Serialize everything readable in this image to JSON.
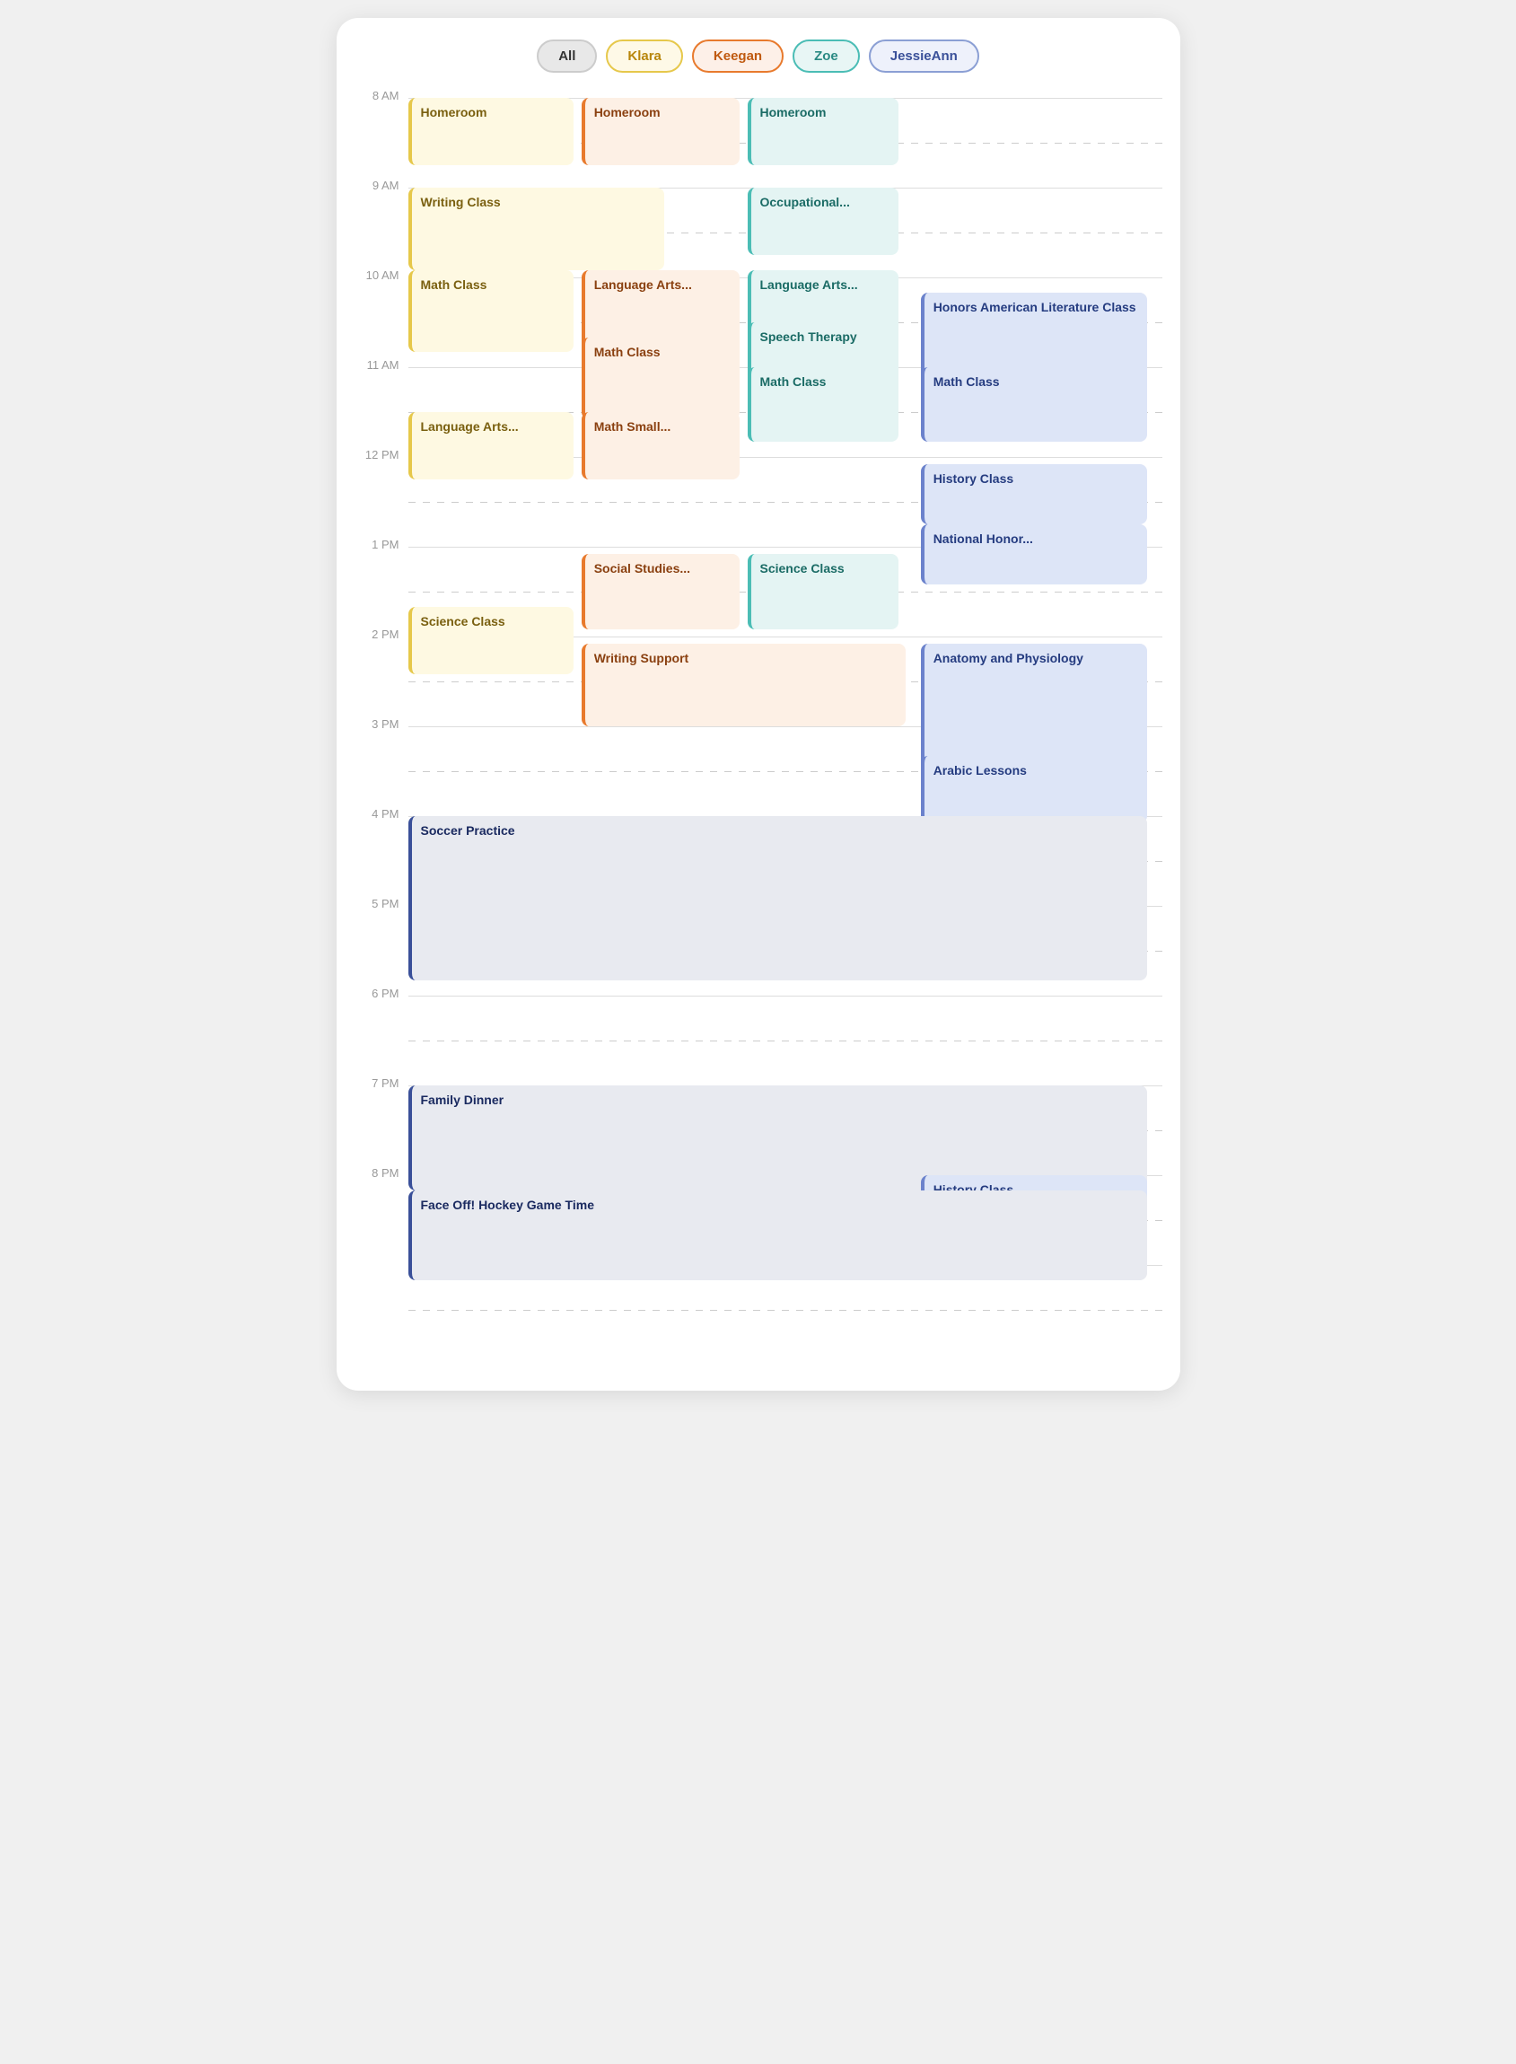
{
  "filters": [
    {
      "id": "all",
      "label": "All",
      "class": "active"
    },
    {
      "id": "klara",
      "label": "Klara",
      "class": "klara"
    },
    {
      "id": "keegan",
      "label": "Keegan",
      "class": "keegan"
    },
    {
      "id": "zoe",
      "label": "Zoe",
      "class": "zoe"
    },
    {
      "id": "jessieann",
      "label": "JessieAnn",
      "class": "jessieann"
    }
  ],
  "hours": [
    {
      "label": "8 AM"
    },
    {
      "label": "9 AM"
    },
    {
      "label": "10 AM"
    },
    {
      "label": "11 AM"
    },
    {
      "label": "12 PM"
    },
    {
      "label": "1 PM"
    },
    {
      "label": "2 PM"
    },
    {
      "label": "3 PM"
    },
    {
      "label": "4 PM"
    },
    {
      "label": "5 PM"
    },
    {
      "label": "6 PM"
    },
    {
      "label": "7 PM"
    },
    {
      "label": "8 PM"
    },
    {
      "label": ""
    }
  ],
  "events": [
    {
      "title": "Homeroom",
      "owner": "klara",
      "top_hour": 0,
      "top_min": 0,
      "dur_min": 45,
      "left_pct": 0,
      "width_pct": 22
    },
    {
      "title": "Homeroom",
      "owner": "keegan",
      "top_hour": 0,
      "top_min": 0,
      "dur_min": 45,
      "left_pct": 23,
      "width_pct": 21
    },
    {
      "title": "Homeroom",
      "owner": "zoe",
      "top_hour": 0,
      "top_min": 0,
      "dur_min": 45,
      "left_pct": 45,
      "width_pct": 20
    },
    {
      "title": "Writing Class",
      "owner": "klara",
      "top_hour": 1,
      "top_min": 0,
      "dur_min": 55,
      "left_pct": 0,
      "width_pct": 34
    },
    {
      "title": "Occupational...",
      "owner": "zoe",
      "top_hour": 1,
      "top_min": 0,
      "dur_min": 45,
      "left_pct": 45,
      "width_pct": 20
    },
    {
      "title": "Math Class",
      "owner": "klara",
      "top_hour": 1,
      "top_min": 55,
      "dur_min": 55,
      "left_pct": 0,
      "width_pct": 22
    },
    {
      "title": "Language Arts...",
      "owner": "keegan",
      "top_hour": 1,
      "top_min": 55,
      "dur_min": 55,
      "left_pct": 23,
      "width_pct": 21
    },
    {
      "title": "Language Arts...",
      "owner": "zoe",
      "top_hour": 1,
      "top_min": 55,
      "dur_min": 55,
      "left_pct": 45,
      "width_pct": 20
    },
    {
      "title": "Honors American Literature Class",
      "owner": "jessieann",
      "top_hour": 2,
      "top_min": 10,
      "dur_min": 80,
      "left_pct": 68,
      "width_pct": 30
    },
    {
      "title": "Math Class",
      "owner": "keegan",
      "top_hour": 2,
      "top_min": 40,
      "dur_min": 55,
      "left_pct": 23,
      "width_pct": 21
    },
    {
      "title": "Speech Therapy",
      "owner": "zoe",
      "top_hour": 2,
      "top_min": 30,
      "dur_min": 55,
      "left_pct": 45,
      "width_pct": 20
    },
    {
      "title": "Math Class",
      "owner": "zoe",
      "top_hour": 3,
      "top_min": 0,
      "dur_min": 50,
      "left_pct": 45,
      "width_pct": 20
    },
    {
      "title": "Math Class",
      "owner": "jessieann",
      "top_hour": 3,
      "top_min": 0,
      "dur_min": 50,
      "left_pct": 68,
      "width_pct": 30
    },
    {
      "title": "Language Arts...",
      "owner": "klara",
      "top_hour": 3,
      "top_min": 30,
      "dur_min": 45,
      "left_pct": 0,
      "width_pct": 22
    },
    {
      "title": "Math Small...",
      "owner": "keegan",
      "top_hour": 3,
      "top_min": 30,
      "dur_min": 45,
      "left_pct": 23,
      "width_pct": 21
    },
    {
      "title": "History Class",
      "owner": "jessieann",
      "top_hour": 4,
      "top_min": 5,
      "dur_min": 40,
      "left_pct": 68,
      "width_pct": 30
    },
    {
      "title": "National Honor...",
      "owner": "jessieann",
      "top_hour": 4,
      "top_min": 45,
      "dur_min": 40,
      "left_pct": 68,
      "width_pct": 30
    },
    {
      "title": "Social Studies...",
      "owner": "keegan",
      "top_hour": 5,
      "top_min": 5,
      "dur_min": 50,
      "left_pct": 23,
      "width_pct": 21
    },
    {
      "title": "Science Class",
      "owner": "zoe",
      "top_hour": 5,
      "top_min": 5,
      "dur_min": 50,
      "left_pct": 45,
      "width_pct": 20
    },
    {
      "title": "Science Class",
      "owner": "klara",
      "top_hour": 5,
      "top_min": 40,
      "dur_min": 45,
      "left_pct": 0,
      "width_pct": 22
    },
    {
      "title": "Writing Support",
      "owner": "keegan",
      "top_hour": 6,
      "top_min": 5,
      "dur_min": 55,
      "left_pct": 23,
      "width_pct": 43
    },
    {
      "title": "Anatomy and Physiology",
      "owner": "jessieann",
      "top_hour": 6,
      "top_min": 5,
      "dur_min": 90,
      "left_pct": 68,
      "width_pct": 30
    },
    {
      "title": "Arabic Lessons",
      "owner": "jessieann",
      "top_hour": 7,
      "top_min": 20,
      "dur_min": 45,
      "left_pct": 68,
      "width_pct": 30
    },
    {
      "title": "Soccer Practice",
      "owner": "all",
      "top_hour": 8,
      "top_min": 0,
      "dur_min": 110,
      "left_pct": 0,
      "width_pct": 98
    },
    {
      "title": "Family Dinner",
      "owner": "all",
      "top_hour": 11,
      "top_min": 0,
      "dur_min": 70,
      "left_pct": 0,
      "width_pct": 98
    },
    {
      "title": "History Class",
      "owner": "jessieann",
      "top_hour": 12,
      "top_min": 0,
      "dur_min": 45,
      "left_pct": 68,
      "width_pct": 30
    },
    {
      "title": "Face Off! Hockey Game Time",
      "owner": "all",
      "top_hour": 12,
      "top_min": 10,
      "dur_min": 60,
      "left_pct": 0,
      "width_pct": 98
    }
  ],
  "colors": {
    "klara_bg": "#fef9e2",
    "klara_border": "#e6c84b",
    "keegan_bg": "#fdf0e5",
    "keegan_border": "#e87a2d",
    "zoe_bg": "#e4f4f3",
    "zoe_border": "#4bbdb5",
    "jessieann_bg": "#dde5f7",
    "jessieann_border": "#6b82cc",
    "all_bg": "#e8eaf0",
    "all_border": "#3a5099"
  }
}
